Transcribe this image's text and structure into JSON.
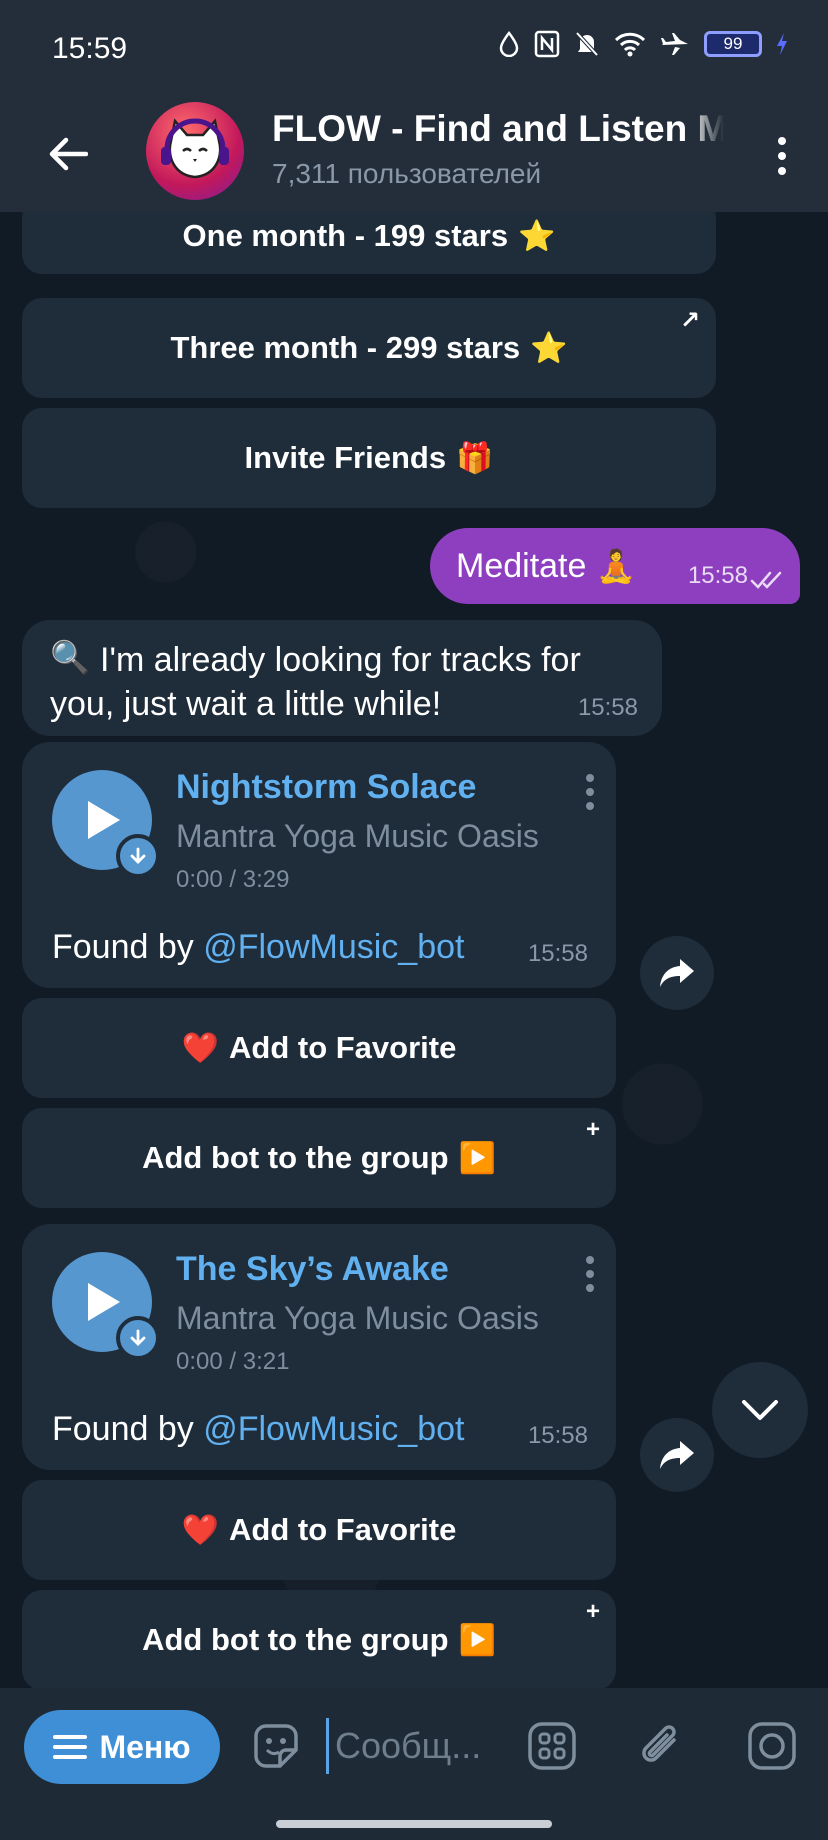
{
  "status_bar": {
    "time": "15:59",
    "battery": "99"
  },
  "header": {
    "title": "FLOW - Find and Listen Music",
    "subtitle": "7,311 пользователей"
  },
  "keyboard_top": [
    {
      "label": "One month - 199 stars",
      "emoji": "⭐"
    },
    {
      "label": "Three month - 299 stars",
      "emoji": "⭐",
      "corner": "↗"
    },
    {
      "label": "Invite Friends",
      "emoji": "🎁"
    }
  ],
  "outgoing_message": {
    "text": "Meditate",
    "emoji": "🧘",
    "time": "15:58"
  },
  "incoming_message": {
    "emoji": "🔍",
    "text": "I'm already looking for tracks for you, just wait a little while!",
    "time": "15:58"
  },
  "tracks": [
    {
      "title": "Nightstorm Solace",
      "artist": "Mantra Yoga Music Oasis",
      "duration": "0:00 / 3:29",
      "caption_prefix": "Found by ",
      "mention": "@FlowMusic_bot",
      "time": "15:58",
      "buttons": [
        {
          "emoji": "❤️",
          "label": "Add to Favorite"
        },
        {
          "label": "Add bot to the group",
          "emoji": "▶️",
          "corner": "+"
        }
      ]
    },
    {
      "title": "The Sky’s Awake",
      "artist": "Mantra Yoga Music Oasis",
      "duration": "0:00 / 3:21",
      "caption_prefix": "Found by ",
      "mention": "@FlowMusic_bot",
      "time": "15:58",
      "buttons": [
        {
          "emoji": "❤️",
          "label": "Add to Favorite"
        },
        {
          "label": "Add bot to the group",
          "emoji": "▶️",
          "corner": "+"
        }
      ]
    }
  ],
  "input_bar": {
    "menu_label": "Меню",
    "placeholder": "Сообщ..."
  },
  "colors": {
    "outgoing_bubble": "#8e3fc0",
    "accent": "#3e8fd6",
    "link": "#61b0ef",
    "bubble": "#1f2c3a",
    "background": "#111b26"
  }
}
